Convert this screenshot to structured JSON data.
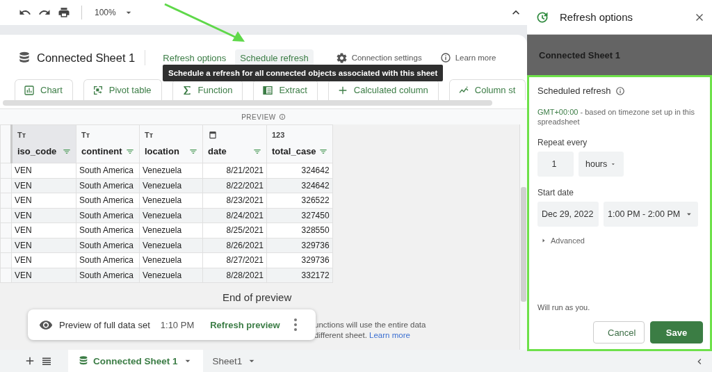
{
  "toolbar": {
    "zoom": "100%"
  },
  "connection": {
    "title": "Connected Sheet 1",
    "tabs": [
      {
        "label": "Refresh options",
        "selected": false
      },
      {
        "label": "Schedule refresh",
        "selected": true
      }
    ],
    "links": [
      {
        "kind": "settings",
        "label": "Connection settings"
      },
      {
        "kind": "info",
        "label": "Learn more"
      }
    ],
    "tooltip": "Schedule a refresh for all connected objects associated with this sheet"
  },
  "actions": [
    {
      "kind": "chart",
      "label": "Chart"
    },
    {
      "kind": "pivot",
      "label": "Pivot table"
    },
    {
      "kind": "function",
      "label": "Function"
    },
    {
      "kind": "extract",
      "label": "Extract"
    },
    {
      "kind": "calculated",
      "label": "Calculated column"
    },
    {
      "kind": "stats",
      "label": "Column st"
    }
  ],
  "preview_label": "PREVIEW",
  "table": {
    "columns": [
      {
        "name": "iso_code",
        "kind": "text",
        "type_label": "Tт",
        "selected": true
      },
      {
        "name": "continent",
        "kind": "text",
        "type_label": "Tт",
        "selected": false
      },
      {
        "name": "location",
        "kind": "text",
        "type_label": "Tт",
        "selected": false
      },
      {
        "name": "date",
        "kind": "date",
        "selected": false
      },
      {
        "name": "total_case",
        "kind": "number",
        "type_label": "123",
        "selected": false
      }
    ],
    "rows": [
      [
        "VEN",
        "South America",
        "Venezuela",
        "8/21/2021",
        "324642"
      ],
      [
        "VEN",
        "South America",
        "Venezuela",
        "8/22/2021",
        "324642"
      ],
      [
        "VEN",
        "South America",
        "Venezuela",
        "8/23/2021",
        "326522"
      ],
      [
        "VEN",
        "South America",
        "Venezuela",
        "8/24/2021",
        "327450"
      ],
      [
        "VEN",
        "South America",
        "Venezuela",
        "8/25/2021",
        "328550"
      ],
      [
        "VEN",
        "South America",
        "Venezuela",
        "8/26/2021",
        "329736"
      ],
      [
        "VEN",
        "South America",
        "Venezuela",
        "8/27/2021",
        "329736"
      ],
      [
        "VEN",
        "South America",
        "Venezuela",
        "8/28/2021",
        "332172"
      ]
    ]
  },
  "end_of_preview": {
    "title": "End of preview",
    "line_1": "unctions will use the entire data",
    "line_2": "different sheet.",
    "link": "Learn more"
  },
  "preview_card": {
    "label": "Preview of full data set",
    "time": "1:10 PM",
    "action": "Refresh preview"
  },
  "sheet_tabs": [
    {
      "label": "Connected Sheet 1",
      "kind": "connected",
      "selected": true
    },
    {
      "label": "Sheet1",
      "kind": "plain",
      "selected": false
    }
  ],
  "panel": {
    "title": "Refresh options",
    "source": "Connected Sheet 1",
    "section_title": "Scheduled refresh",
    "timezone": "GMT+00:00",
    "timezone_note": " - based on timezone set up in this spreadsheet",
    "repeat_label": "Repeat every",
    "repeat_value": "1",
    "repeat_unit": "hours",
    "start_label": "Start date",
    "start_date": "Dec 29, 2022",
    "start_time": "1:00 PM - 2:00 PM",
    "advanced": {
      "label": "Advanced",
      "expanded": false
    },
    "footer": "Will run as you.",
    "buttons": [
      {
        "kind": "secondary",
        "label": "Cancel"
      },
      {
        "kind": "primary",
        "label": "Save"
      }
    ]
  }
}
